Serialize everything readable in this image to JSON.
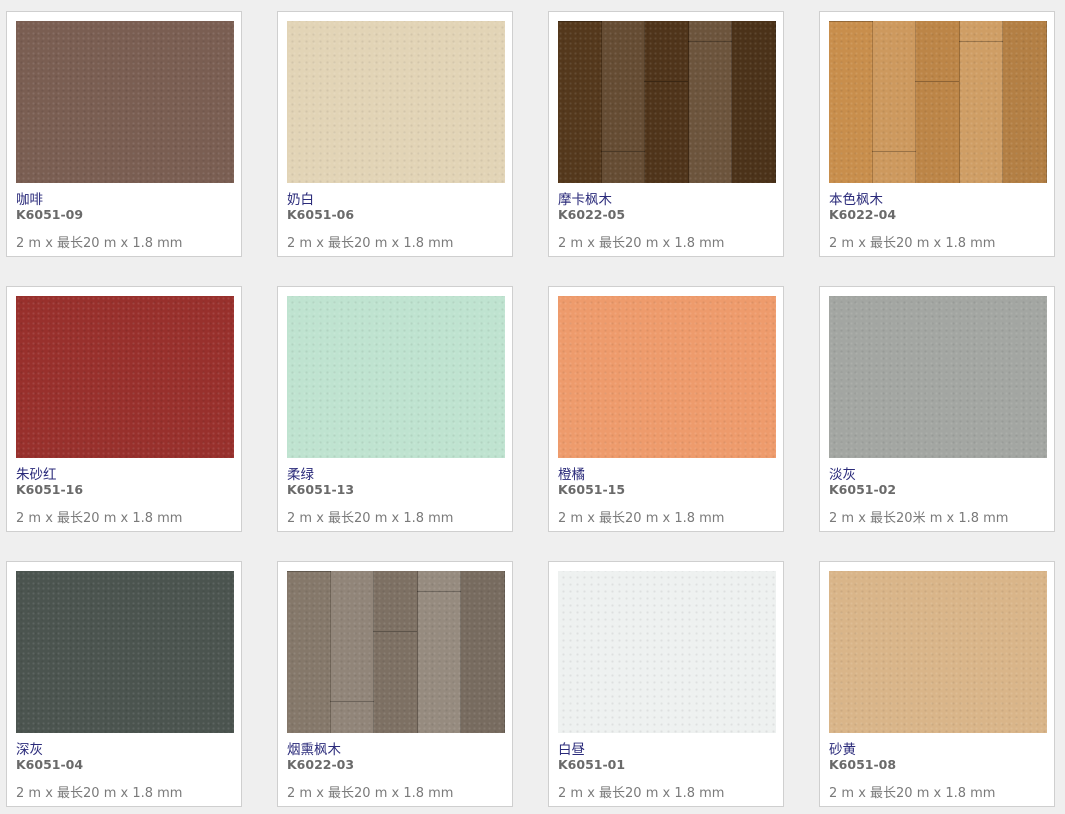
{
  "products": [
    {
      "name": "咖啡",
      "code": "K6051-09",
      "size": "2 m x 最长20 m x 1.8 mm",
      "color": "#7a5e52",
      "texture": "plain",
      "icon": "swatch-coffee"
    },
    {
      "name": "奶白",
      "code": "K6051-06",
      "size": "2 m x 最长20 m x 1.8 mm",
      "color": "#e2d4b6",
      "texture": "plain",
      "icon": "swatch-cream"
    },
    {
      "name": "摩卡枫木",
      "code": "K6022-05",
      "size": "2 m x 最长20 m x 1.8 mm",
      "color": "#54381c",
      "texture": "wood",
      "icon": "swatch-mocha-maple"
    },
    {
      "name": "本色枫木",
      "code": "K6022-04",
      "size": "2 m x 最长20 m x 1.8 mm",
      "color": "#c88e4c",
      "texture": "wood",
      "icon": "swatch-natural-maple"
    },
    {
      "name": "朱砂红",
      "code": "K6051-16",
      "size": "2 m x 最长20 m x 1.8 mm",
      "color": "#98302c",
      "texture": "plain",
      "icon": "swatch-cinnabar-red"
    },
    {
      "name": "柔绿",
      "code": "K6051-13",
      "size": "2 m x 最长20 m x 1.8 mm",
      "color": "#bfe3d0",
      "texture": "plain",
      "icon": "swatch-soft-green"
    },
    {
      "name": "橙橘",
      "code": "K6051-15",
      "size": "2 m x 最长20 m x 1.8 mm",
      "color": "#ee9b6c",
      "texture": "plain",
      "icon": "swatch-orange"
    },
    {
      "name": "淡灰",
      "code": "K6051-02",
      "size": "2 m x 最长20米 m x 1.8 mm",
      "color": "#a3a6a2",
      "texture": "plain",
      "icon": "swatch-light-grey"
    },
    {
      "name": "深灰",
      "code": "K6051-04",
      "size": "2 m x 最长20 m x 1.8 mm",
      "color": "#4b544f",
      "texture": "plain",
      "icon": "swatch-dark-grey"
    },
    {
      "name": "烟熏枫木",
      "code": "K6022-03",
      "size": "2 m x 最长20 m x 1.8 mm",
      "color": "#85786a",
      "texture": "wood",
      "icon": "swatch-smoked-maple"
    },
    {
      "name": "白昼",
      "code": "K6051-01",
      "size": "2 m x 最长20 m x 1.8 mm",
      "color": "#eef1f0",
      "texture": "plain",
      "icon": "swatch-daylight"
    },
    {
      "name": "砂黄",
      "code": "K6051-08",
      "size": "2 m x 最长20 m x 1.8 mm",
      "color": "#d9b589",
      "texture": "plain",
      "icon": "swatch-sand-yellow"
    }
  ]
}
